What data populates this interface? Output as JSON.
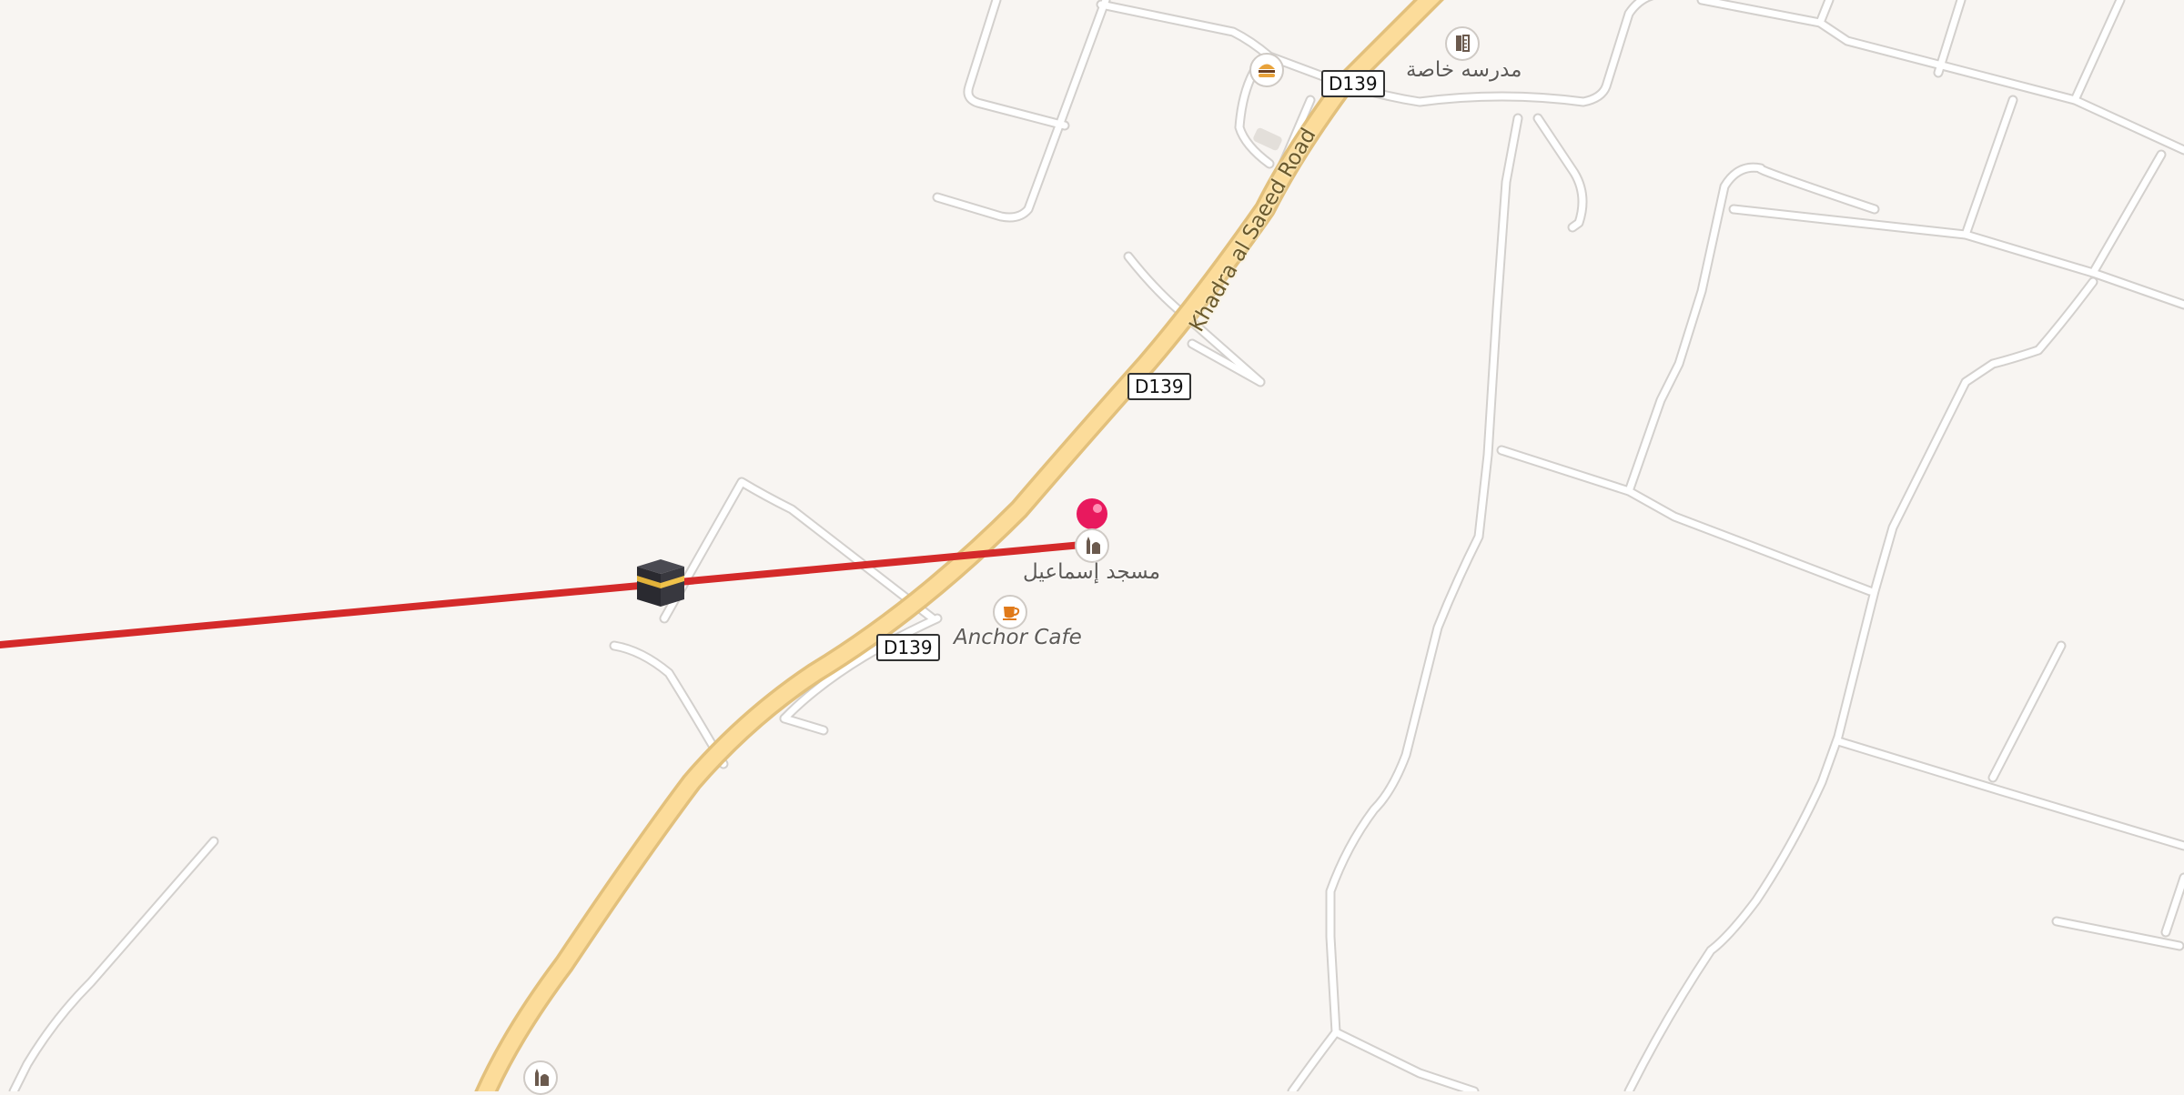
{
  "map": {
    "background_color": "#f8f5f2",
    "route_color": "#d42a2a",
    "marker_color": "#e8195e"
  },
  "roads": {
    "main_road": {
      "name": "Khadra al Saeed Road",
      "ref": "D139"
    }
  },
  "pois": {
    "mosque": {
      "label": "مسجد إسماعيل",
      "icon": "mosque-icon"
    },
    "cafe": {
      "label": "Anchor Cafe",
      "icon": "cafe-icon"
    },
    "school": {
      "label": "مدرسه خاصة",
      "icon": "school-icon"
    },
    "fast_food": {
      "icon": "burger-icon"
    },
    "mosque_south": {
      "icon": "mosque-icon"
    }
  },
  "route": {
    "start_icon": "kaaba-icon",
    "end_icon": "location-pin-icon"
  }
}
